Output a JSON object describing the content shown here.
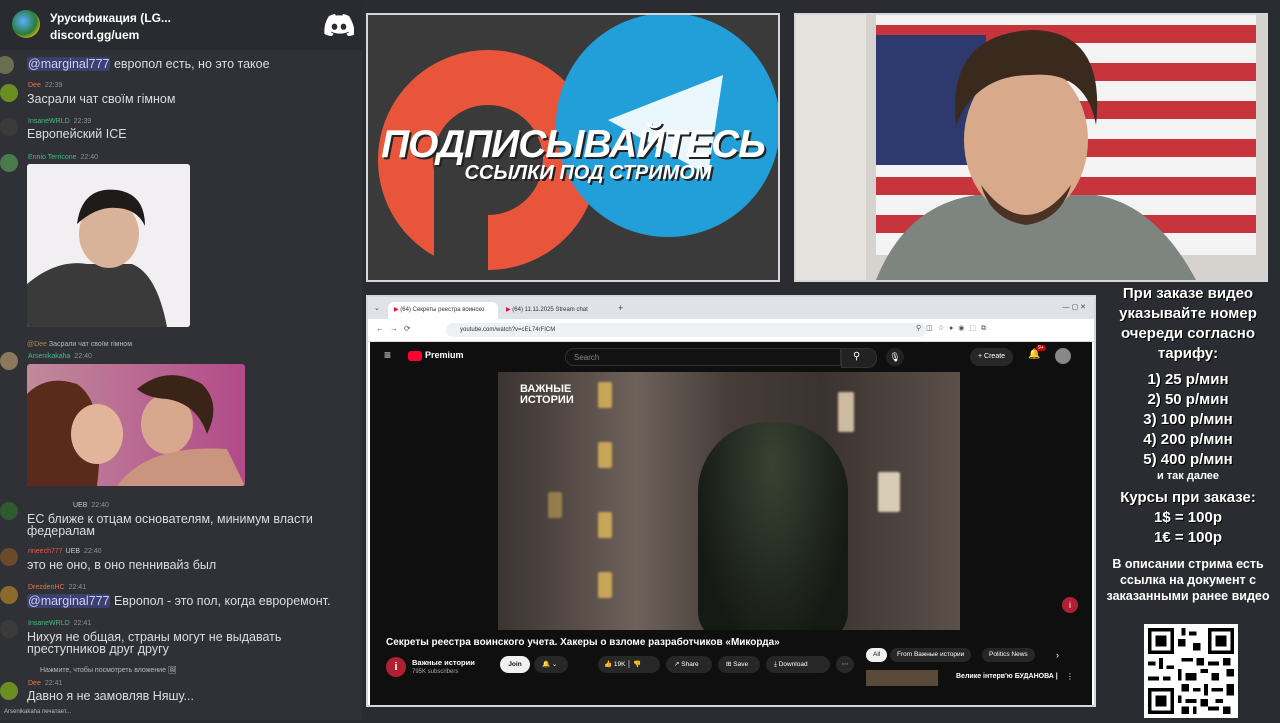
{
  "chat": {
    "server_name": "Урусификация (LG...",
    "server_link": "discord.gg/uem",
    "messages": [
      {
        "author": "",
        "time": "",
        "text_mention": "@marginal777",
        "text": " европол есть, но это такое"
      },
      {
        "author": "Dee",
        "time": "22:39",
        "text": "Засрали чат своїм гімном"
      },
      {
        "author": "InsaneWRLD",
        "time": "22:39",
        "text": "Европейский ICE"
      },
      {
        "author": "Ennio Terricone",
        "time": "22:40"
      },
      {
        "author": "Arsenikakaha",
        "time": "22:40",
        "reply_name": "@Dee",
        "reply_text": "Засрали чат своїм гімном"
      },
      {
        "author": "",
        "badge": "UEB",
        "time": "22:40",
        "text": "ЕС ближе к отцам основателям, минимум власти",
        "text2": "федералам"
      },
      {
        "author": "rineech777",
        "badge": "UEB",
        "time": "22:40",
        "text": "это не оно, в оно пеннивайз был"
      },
      {
        "author": "DrezdenHC",
        "time": "22:41",
        "text_mention": "@marginal777",
        "text": " Европол - это пол, когда евроремонт."
      },
      {
        "author": "InsaneWRLD",
        "time": "22:41",
        "text": "Нихуя не общая, страны могут не выдавать",
        "text2": "преступников друг другу"
      },
      {
        "author": "",
        "reply_text": "Нажмите, чтобы посмотреть вложение"
      },
      {
        "author": "Dee",
        "time": "22:41",
        "text": "Давно я не замовляв Няшу..."
      },
      {
        "author": "Arsenikakaha",
        "text": "печатает..."
      }
    ]
  },
  "promo": {
    "line1": "ПОДПИСЫВАЙТЕСЬ",
    "line2": "ССЫЛКИ ПОД СТРИМОМ"
  },
  "browser": {
    "tab1": "(64) Секреты реестра воинско",
    "tab2": "(64) 11.11.2025 Stream chat",
    "url": "youtube.com/watch?v=cEL74rFICM"
  },
  "youtube": {
    "brand": "Premium",
    "search_placeholder": "Search",
    "create": "Create",
    "notif_count": "9+",
    "channel_watermark": "ВАЖНЫЕ ИСТОРИИ",
    "video_title": "Секреты реестра воинского учета. Хакеры о взломе разработчиков «Микорда»",
    "channel_name": "Важные истории",
    "subscribers": "795K subscribers",
    "join": "Join",
    "likes": "19K",
    "share": "Share",
    "save": "Save",
    "download": "Download",
    "chips": [
      "All",
      "From Важные истории",
      "Politics News"
    ],
    "rec_title": "Велике інтерв'ю БУДАНОВА |"
  },
  "info": {
    "order_text": "При заказе видео указывайте номер очереди согласно тарифу:",
    "tariffs": [
      "1) 25 р/мин",
      "2) 50 р/мин",
      "3) 100 р/мин",
      "4) 200 р/мин",
      "5) 400 р/мин"
    ],
    "etc": "и так далее",
    "rates_title": "Курсы при заказе:",
    "rate1": "1$ = 100р",
    "rate2": "1€ = 100р",
    "desc": "В описании стрима есть ссылка на документ с заказанными ранее видео"
  },
  "colors": {
    "brand_red": "#ff0033",
    "chat_bg": "#2f3136",
    "telegram_blue": "#229ed9",
    "patreon_orange": "#e8553b"
  }
}
